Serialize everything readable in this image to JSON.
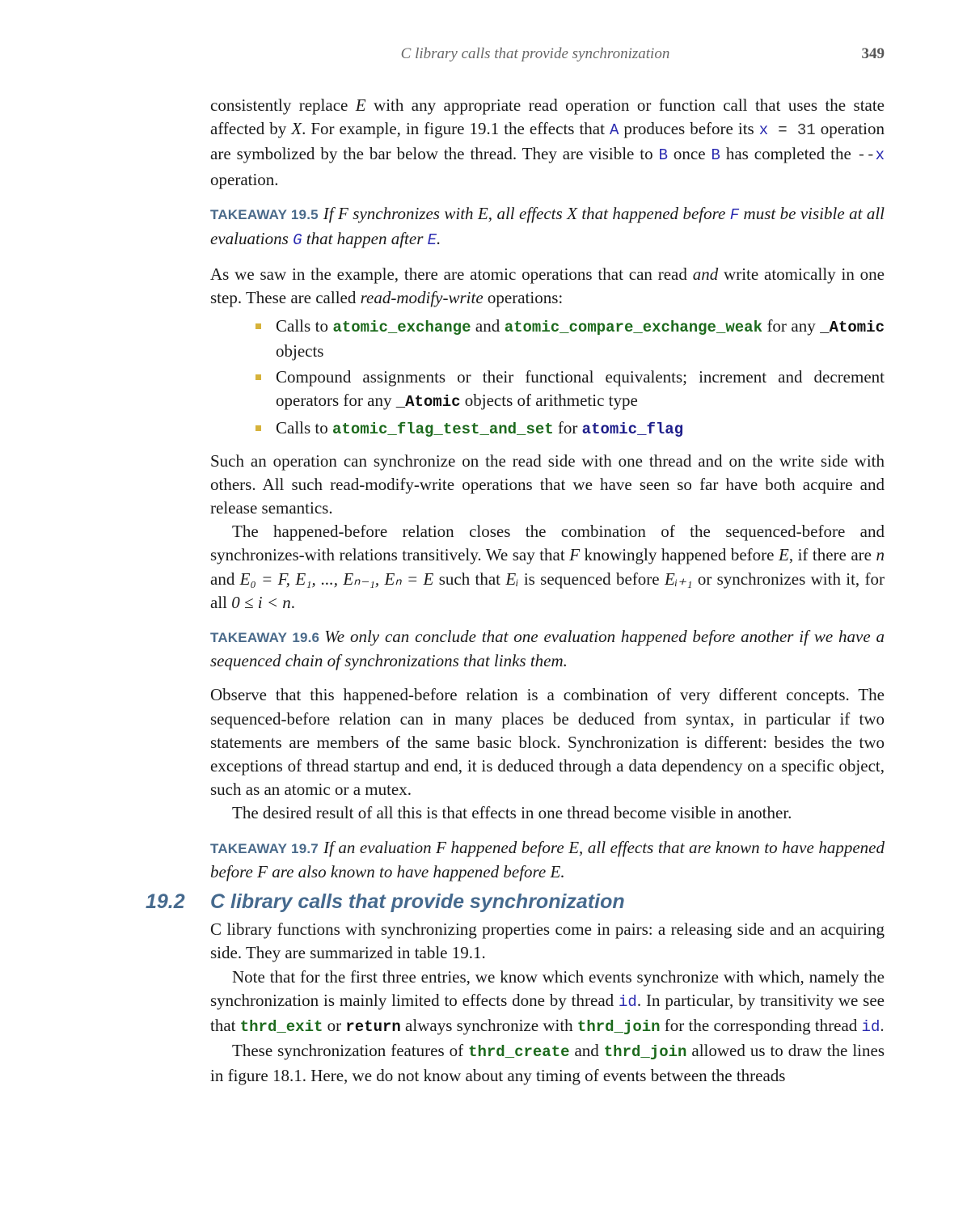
{
  "header": {
    "running_title": "C library calls that provide synchronization",
    "page_number": "349"
  },
  "para1": {
    "t1": "consistently replace ",
    "E": "E",
    "t2": " with any appropriate read operation or function call that uses the state affected by ",
    "X": "X",
    "t3": ". For example, in figure 19.1 the effects that ",
    "A": "A",
    "t4": " produces before its ",
    "x": "x",
    "eq31": " = 31",
    "t5": " operation are symbolized by the bar below the thread. They are visible to ",
    "B1": "B",
    "t6": " once ",
    "B2": "B",
    "t7": " has completed the ",
    "dec": "--",
    "x2": "x",
    "t8": " operation."
  },
  "takeaway1": {
    "label": "TAKEAWAY 19.5",
    "t1": "If ",
    "F": "F",
    "t2": " synchronizes with ",
    "E": "E",
    "t3": ", all effects ",
    "X": "X",
    "t4": " that happened before ",
    "Fc": "F",
    "t5": " must be visible at all evaluations ",
    "G": "G",
    "t6": " that happen after ",
    "Ec": "E",
    "t7": "."
  },
  "para2": {
    "t1": "As we saw in the example, there are atomic operations that can read ",
    "and": "and",
    "t2": " write atomically in one step. These are called ",
    "rmw": "read-modify-write",
    "t3": " operations:"
  },
  "bullets": [
    {
      "t1": "Calls to ",
      "c1": "atomic_exchange",
      "t2": " and ",
      "c2": "atomic_compare_exchange_weak",
      "t3": " for any ",
      "c3": "_Atomic",
      "t4": " objects"
    },
    {
      "t1": "Compound assignments or their functional equivalents; increment and decrement operators for any ",
      "c1": "_Atomic",
      "t2": " objects of arithmetic type"
    },
    {
      "t1": "Calls to ",
      "c1": "atomic_flag_test_and_set",
      "t2": " for ",
      "c2": "atomic_flag"
    }
  ],
  "para3": "Such an operation can synchronize on the read side with one thread and on the write side with others. All such read-modify-write operations that we have seen so far have both acquire and release semantics.",
  "para4": {
    "t1": "The happened-before relation closes the combination of the sequenced-before and synchronizes-with relations transitively. We say that ",
    "F": "F",
    "t2": " knowingly happened before ",
    "E": "E",
    "t3": ", if there are ",
    "n": "n",
    "t4": " and ",
    "chain": "E₀ = F, E₁, ..., Eₙ₋₁, Eₙ = E",
    "t5": " such that ",
    "Ei": "Eᵢ",
    "t6": " is sequenced before ",
    "Ei1": "Eᵢ₊₁",
    "t7": " or synchronizes with it, for all ",
    "range": "0 ≤ i < n",
    "t8": "."
  },
  "takeaway2": {
    "label": "TAKEAWAY 19.6",
    "text": "We only can conclude that one evaluation happened before another if we have a sequenced chain of synchronizations that links them."
  },
  "para5": "Observe that this happened-before relation is a combination of very different concepts. The sequenced-before relation can in many places be deduced from syntax, in particular if two statements are members of the same basic block. Synchronization is different: besides the two exceptions of thread startup and end, it is deduced through a data dependency on a specific object, such as an atomic or a mutex.",
  "para6": "The desired result of all this is that effects in one thread become visible in another.",
  "takeaway3": {
    "label": "TAKEAWAY 19.7",
    "t1": "If an evaluation ",
    "F": "F",
    "t2": " happened before ",
    "E": "E",
    "t3": ", all effects that are known to have happened before ",
    "F2": "F",
    "t4": " are also known to have happened before ",
    "E2": "E",
    "t5": "."
  },
  "section": {
    "number": "19.2",
    "title": "C library calls that provide synchronization"
  },
  "para7": "C library functions with synchronizing properties come in pairs: a releasing side and an acquiring side. They are summarized in table 19.1.",
  "para8": {
    "t1": "Note that for the first three entries, we know which events synchronize with which, namely the synchronization is mainly limited to effects done by thread ",
    "id1": "id",
    "t2": ". In particular, by transitivity we see that ",
    "c1": "thrd_exit",
    "t3": " or ",
    "kw": "return",
    "t4": " always synchronize with ",
    "c2": "thrd_join",
    "t5": " for the corresponding thread ",
    "id2": "id",
    "t6": "."
  },
  "para9": {
    "t1": "These synchronization features of ",
    "c1": "thrd_create",
    "t2": " and ",
    "c2": "thrd_join",
    "t3": " allowed us to draw the lines in figure 18.1. Here, we do not know about any timing of events between the threads"
  },
  "colors": {
    "takeaway_label": "#4a6a8a",
    "section_heading": "#466a8e",
    "bullet": "#d6b23a",
    "code_variable": "#2a2ab0",
    "code_function": "#1d6a1d",
    "code_type": "#1d1d8a"
  }
}
